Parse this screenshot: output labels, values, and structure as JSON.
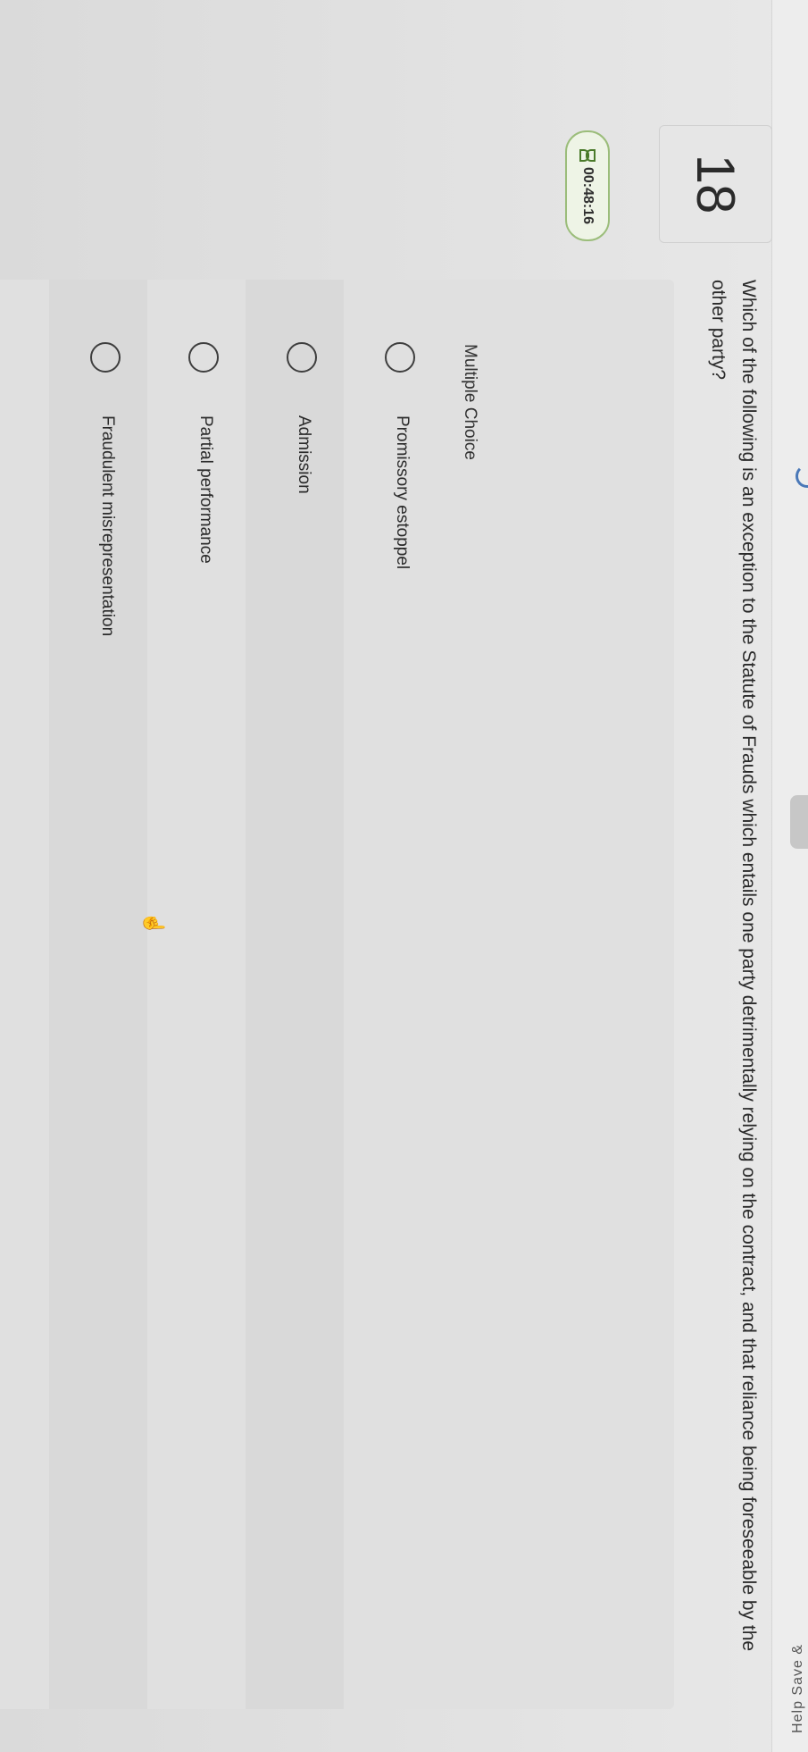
{
  "question_number": "18",
  "timer": {
    "value": "00:48:16",
    "icon": "hourglass-icon"
  },
  "question_text": "Which of the following is an exception to the Statute of Frauds which entails one party detrimentally relying on the contract, and that reliance being foreseeable by the other party?",
  "question_type": "Multiple Choice",
  "options": [
    {
      "label": "Promissory estoppel"
    },
    {
      "label": "Admission"
    },
    {
      "label": "Partial performance"
    },
    {
      "label": "Fraudulent misrepresentation"
    }
  ],
  "corner_text": "Help   Save &",
  "colors": {
    "timer_border": "#9bbd7a",
    "timer_bg": "#eef4e6",
    "accent": "#4a78b8"
  }
}
